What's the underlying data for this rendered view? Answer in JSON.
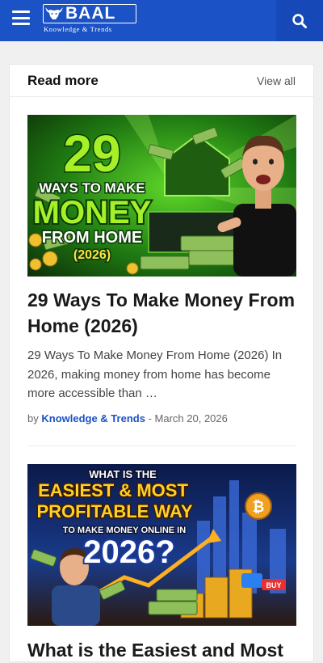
{
  "header": {
    "logo_name": "BAAL",
    "logo_tagline": "Knowledge & Trends",
    "menu_icon": "hamburger-menu-icon",
    "search_icon": "search-icon",
    "brand_color": "#1b52c6"
  },
  "section": {
    "title": "Read more",
    "view_all": "View all"
  },
  "posts": [
    {
      "thumb": {
        "line1": "29",
        "line2": "WAYS TO MAKE",
        "line3": "MONEY",
        "line4": "FROM HOME",
        "line5": "(2026)"
      },
      "title": "29 Ways To Make Money From Home (2026)",
      "excerpt": "29 Ways To Make Money From Home (2026) In 2026, making money from home has become more accessible than …",
      "by": "by",
      "author": "Knowledge & Trends",
      "sep": "-",
      "date": "March 20, 2026"
    },
    {
      "thumb": {
        "line1": "WHAT IS THE",
        "line2": "EASIEST & MOST",
        "line3": "PROFITABLE WAY",
        "line4": "TO MAKE MONEY ONLINE IN",
        "line5": "2026?",
        "badge": "BUY"
      },
      "title": "What is the Easiest and Most"
    }
  ]
}
